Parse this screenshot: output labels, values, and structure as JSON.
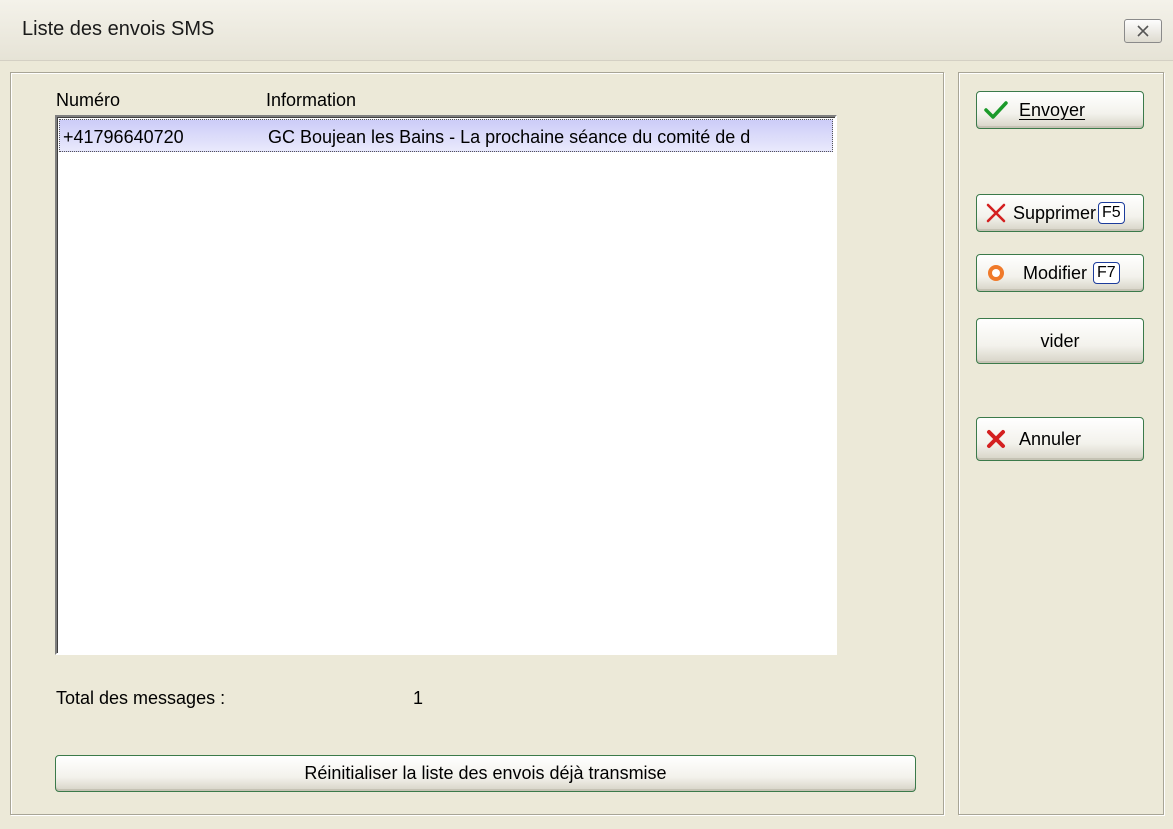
{
  "window": {
    "title": "Liste des envois SMS"
  },
  "list": {
    "columns": {
      "numero": "Numéro",
      "information": "Information"
    },
    "rows": [
      {
        "numero": "+41796640720",
        "information": "GC Boujean les Bains - La prochaine séance du comité de d"
      }
    ]
  },
  "summary": {
    "total_label": "Total des messages :",
    "total_value": "1"
  },
  "buttons": {
    "envoyer": {
      "label": "Envoyer",
      "icon": "checkmark-icon"
    },
    "supprimer": {
      "label": "Supprimer",
      "shortcut": "F5",
      "icon": "red-x-icon"
    },
    "modifier": {
      "label": "Modifier",
      "shortcut": "F7",
      "icon": "orange-circle-icon"
    },
    "vider": {
      "label": "vider"
    },
    "annuler": {
      "label": "Annuler",
      "icon": "cancel-x-icon"
    },
    "reset": {
      "label": "Réinitialiser la liste des envois déjà transmise"
    }
  },
  "colors": {
    "background": "#ece9d8",
    "selection": "#ccccf8",
    "button_border": "#3b7a4a",
    "check_green": "#1b9a2a",
    "delete_red": "#d42020",
    "modify_orange": "#f07a2a"
  }
}
